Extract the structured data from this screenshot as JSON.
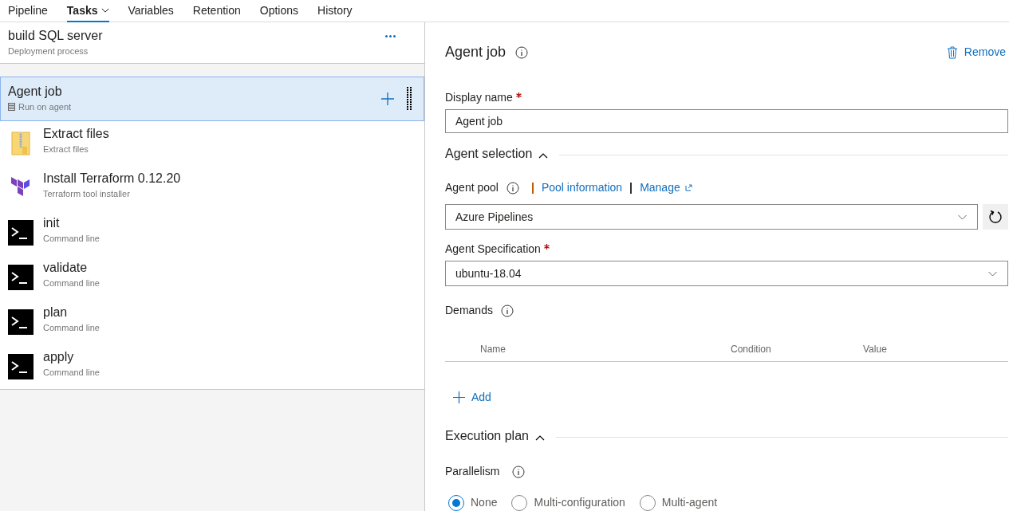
{
  "tabs": [
    {
      "label": "Pipeline",
      "selected": false,
      "dropdown": false
    },
    {
      "label": "Tasks",
      "selected": true,
      "dropdown": true
    },
    {
      "label": "Variables",
      "selected": false,
      "dropdown": false
    },
    {
      "label": "Retention",
      "selected": false,
      "dropdown": false
    },
    {
      "label": "Options",
      "selected": false,
      "dropdown": false
    },
    {
      "label": "History",
      "selected": false,
      "dropdown": false
    }
  ],
  "process": {
    "title": "build SQL server",
    "subtitle": "Deployment process"
  },
  "job": {
    "title": "Agent job",
    "subtitle": "Run on agent",
    "selected": true
  },
  "tasks": [
    {
      "kind": "zip",
      "title": "Extract files",
      "subtitle": "Extract files"
    },
    {
      "kind": "terraform",
      "title": "Install Terraform 0.12.20",
      "subtitle": "Terraform tool installer"
    },
    {
      "kind": "cmd",
      "title": "init",
      "subtitle": "Command line"
    },
    {
      "kind": "cmd",
      "title": "validate",
      "subtitle": "Command line"
    },
    {
      "kind": "cmd",
      "title": "plan",
      "subtitle": "Command line"
    },
    {
      "kind": "cmd",
      "title": "apply",
      "subtitle": "Command line"
    }
  ],
  "details": {
    "title": "Agent job",
    "remove": "Remove",
    "display_name": {
      "label": "Display name",
      "required": true,
      "value": "Agent job"
    },
    "agent_selection": {
      "title": "Agent selection",
      "expanded": true,
      "pool_label": "Agent pool",
      "pool_links": [
        "Pool information",
        "Manage"
      ],
      "pool_value": "Azure Pipelines",
      "spec_label": "Agent Specification",
      "spec_required": true,
      "spec_value": "ubuntu-18.04",
      "demands_label": "Demands",
      "demand_columns": [
        "Name",
        "Condition",
        "Value"
      ],
      "add": "Add"
    },
    "execution_plan": {
      "title": "Execution plan",
      "expanded": true,
      "parallelism_label": "Parallelism",
      "options": [
        {
          "label": "None",
          "selected": true
        },
        {
          "label": "Multi-configuration",
          "selected": false
        },
        {
          "label": "Multi-agent",
          "selected": false
        }
      ]
    }
  }
}
